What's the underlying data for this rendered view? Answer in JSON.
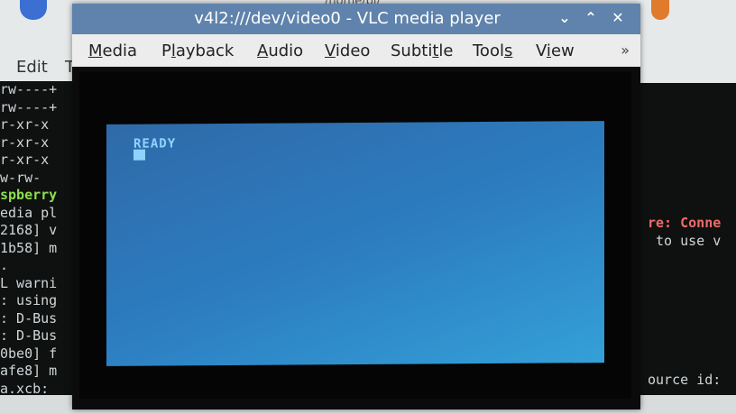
{
  "background": {
    "menu_edit": "Edit",
    "menu_t": "T",
    "top_fragment": "/home/pi/",
    "terminal_left_lines": [
      {
        "text": "rw----+",
        "green": false
      },
      {
        "text": "rw----+",
        "green": false
      },
      {
        "text": "r-xr-x",
        "green": false
      },
      {
        "text": "r-xr-x",
        "green": false
      },
      {
        "text": "r-xr-x",
        "green": false
      },
      {
        "text": "w-rw-",
        "green": false
      },
      {
        "text": "spberry",
        "green": true
      },
      {
        "text": "edia pl",
        "green": false
      },
      {
        "text": "2168] v",
        "green": false
      },
      {
        "text": "1b58] m",
        "green": false
      },
      {
        "text": ".",
        "green": false
      },
      {
        "text": "L warni",
        "green": false
      },
      {
        "text": ": using",
        "green": false
      },
      {
        "text": ": D-Bus",
        "green": false
      },
      {
        "text": ": D-Bus",
        "green": false
      },
      {
        "text": "0be0] f",
        "green": false
      },
      {
        "text": "afe8] m",
        "green": false
      },
      {
        "text": "a.xcb:",
        "green": false
      }
    ],
    "terminal_right": {
      "line1": "re: Conne",
      "line2": " to use v",
      "line3": "ource id:"
    }
  },
  "vlc": {
    "title": "v4l2:///dev/video0 - VLC media player",
    "window_buttons": {
      "minimize": "⌄",
      "maximize": "⌃",
      "close": "✕"
    },
    "menu": [
      {
        "pre": "",
        "u": "M",
        "post": "edia"
      },
      {
        "pre": "P",
        "u": "l",
        "post": "ayback"
      },
      {
        "pre": "",
        "u": "A",
        "post": "udio"
      },
      {
        "pre": "",
        "u": "V",
        "post": "ideo"
      },
      {
        "pre": "Subti",
        "u": "t",
        "post": "le"
      },
      {
        "pre": "Tool",
        "u": "s",
        "post": ""
      },
      {
        "pre": "V",
        "u": "i",
        "post": "ew"
      }
    ],
    "overflow": "»",
    "screen_text": "READY"
  },
  "colors": {
    "titlebar": "#5f83ac",
    "menubar": "#ececec",
    "screen_blue": "#2c7cc0",
    "ready_text": "#8fd2ff"
  }
}
